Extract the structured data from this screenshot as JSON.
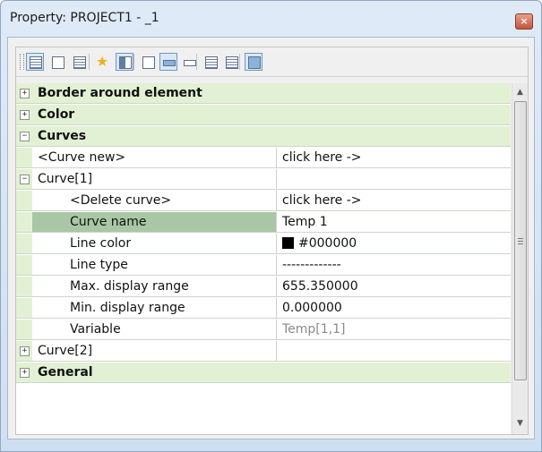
{
  "window": {
    "title": "Property: PROJECT1 - _1",
    "close_label": "×"
  },
  "toolbar": {
    "buttons": [
      {
        "icon": "categorized-view-icon",
        "pressed": true
      },
      {
        "icon": "alphabetical-view-icon",
        "pressed": false
      },
      {
        "icon": "object-list-icon",
        "pressed": false
      },
      {
        "icon": "favorites-star-icon",
        "pressed": false
      },
      {
        "icon": "property-pages-icon",
        "pressed": true
      },
      {
        "icon": "sort-icon",
        "pressed": false
      },
      {
        "icon": "field-edit-icon",
        "pressed": true
      },
      {
        "icon": "field-view-icon",
        "pressed": false
      },
      {
        "icon": "expand-all-icon",
        "pressed": false
      },
      {
        "icon": "collapse-all-icon",
        "pressed": false
      },
      {
        "icon": "calculator-icon",
        "pressed": true
      }
    ]
  },
  "grid": {
    "rows": [
      {
        "type": "category",
        "expander": "+",
        "name": "Border around element"
      },
      {
        "type": "category",
        "expander": "+",
        "name": "Color"
      },
      {
        "type": "category",
        "expander": "−",
        "name": "Curves"
      },
      {
        "type": "property",
        "name": "<Curve new>",
        "value": "click here ->"
      },
      {
        "type": "property",
        "expander": "−",
        "name": "Curve[1]",
        "value": ""
      },
      {
        "type": "property",
        "indent": true,
        "name": "<Delete curve>",
        "value": "click here ->"
      },
      {
        "type": "property",
        "indent": true,
        "selected": true,
        "name": "Curve name",
        "value": "Temp 1"
      },
      {
        "type": "property",
        "indent": true,
        "name": "Line color",
        "value": "#000000",
        "swatch": "#000000"
      },
      {
        "type": "property",
        "indent": true,
        "name": "Line type",
        "value": "-------------"
      },
      {
        "type": "property",
        "indent": true,
        "name": "Max. display range",
        "value": "655.350000"
      },
      {
        "type": "property",
        "indent": true,
        "name": "Min. display range",
        "value": "0.000000"
      },
      {
        "type": "property",
        "indent": true,
        "name": "Variable",
        "value": "Temp[1,1]",
        "gray": true
      },
      {
        "type": "property",
        "expander": "+",
        "name": "Curve[2]",
        "value": ""
      },
      {
        "type": "category",
        "expander": "+",
        "name": "General"
      }
    ]
  },
  "scrollbar": {
    "up_label": "▲",
    "down_label": "▼"
  }
}
